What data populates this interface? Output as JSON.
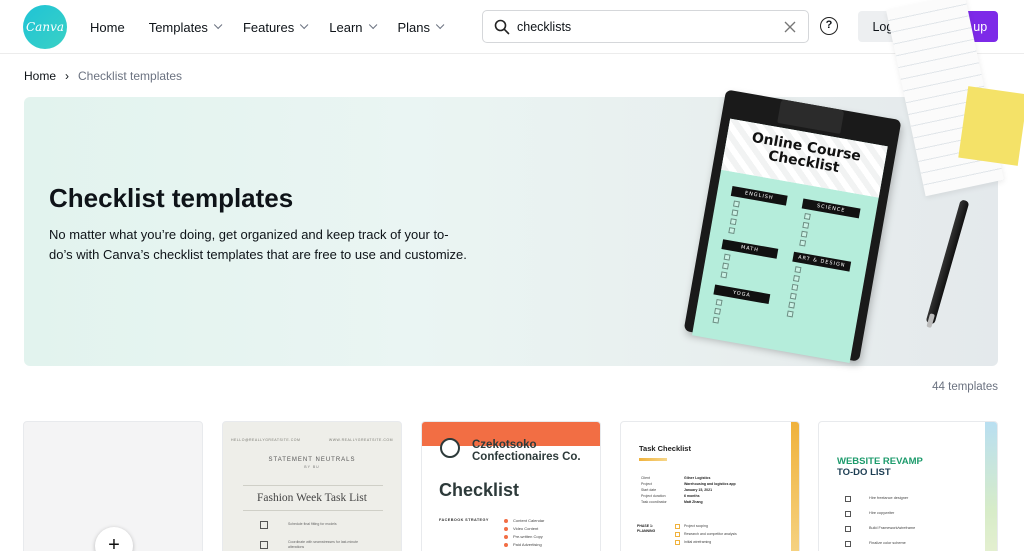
{
  "brand": {
    "logo_text": "Canva",
    "accent": "#7d2ae8",
    "logo_color": "#1fc3d6"
  },
  "nav": {
    "items": [
      {
        "label": "Home",
        "has_chevron": false
      },
      {
        "label": "Templates",
        "has_chevron": true
      },
      {
        "label": "Features",
        "has_chevron": true
      },
      {
        "label": "Learn",
        "has_chevron": true
      },
      {
        "label": "Plans",
        "has_chevron": true
      }
    ]
  },
  "search": {
    "value": "checklists",
    "placeholder": "Search",
    "icon": "search-icon",
    "clear_icon": "close-icon"
  },
  "header_actions": {
    "help_label": "?",
    "login_label": "Log in",
    "signup_label": "Sign up"
  },
  "breadcrumb": {
    "home": "Home",
    "separator": "›",
    "current": "Checklist templates"
  },
  "hero": {
    "title": "Checklist templates",
    "description": "No matter what you’re doing, get organized and keep track of your to-do’s with Canva’s checklist templates that are free to use and customize.",
    "illustration": {
      "sheet_title": "Online Course Checklist",
      "tags": [
        "ENGLISH",
        "SCIENCE",
        "MATH",
        "ART & DESIGN",
        "YOGA"
      ]
    }
  },
  "results": {
    "count_label": "44 templates"
  },
  "cards": {
    "create": {
      "plus": "+"
    },
    "fashion": {
      "email_left": "HELLO@REALLYGREATSITE.COM",
      "email_right": "WWW.REALLYGREATSITE.COM",
      "brand": "STATEMENT NEUTRALS",
      "brand_sub": "BY BU",
      "title": "Fashion Week Task List",
      "items": [
        "Schedule final fitting for models",
        "Coordinate with seamstresses for last-minute alterations"
      ]
    },
    "confection": {
      "company": "Czekotsoko Confectionaires Co.",
      "title": "Checklist",
      "section": "FACEBOOK STRATEGY",
      "items": [
        "Content Calendar",
        "Video Content",
        "Pre-written Copy",
        "Paid Advertising"
      ]
    },
    "task": {
      "title": "Task Checklist",
      "fields": [
        {
          "k": "Client",
          "v": "Gilner Logistics"
        },
        {
          "k": "Project",
          "v": "Warehousing and logistics app"
        },
        {
          "k": "Start date",
          "v": "January 15, 2021"
        },
        {
          "k": "Project duration",
          "v": "6 months"
        },
        {
          "k": "Task coordinator",
          "v": "Matt Zhang"
        }
      ],
      "phase": "PHASE 1: PLANNING",
      "items": [
        "Project scoping",
        "Research and competitor analysis",
        "Initial wireframing"
      ]
    },
    "website": {
      "title_line1": "WEBSITE REVAMP",
      "title_line2": "TO-DO LIST",
      "items": [
        "Hire freelance designer",
        "Hire copywriter",
        "Build Framework/wireframe",
        "Finalize color scheme"
      ]
    }
  }
}
